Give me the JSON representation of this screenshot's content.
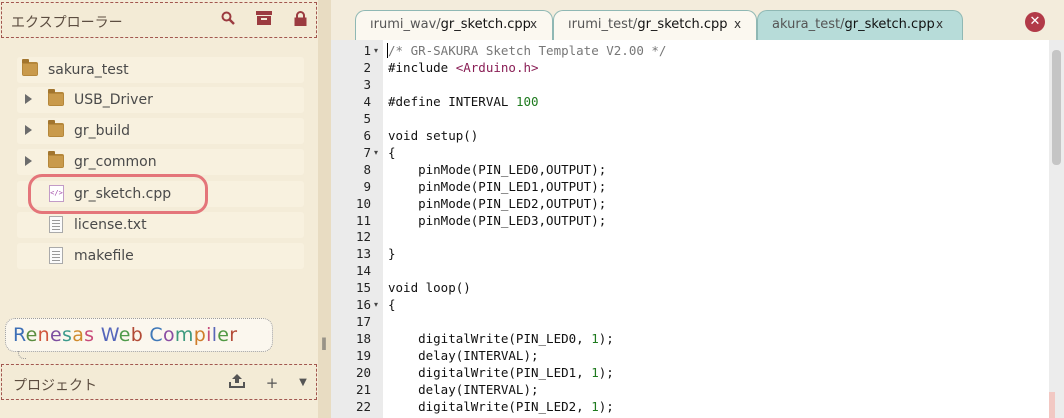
{
  "explorer": {
    "title": "エクスプローラー",
    "icons": [
      "search-icon",
      "archive-icon",
      "lock-icon"
    ],
    "tree": [
      {
        "label": "sakura_test",
        "type": "folder",
        "expandable": false
      },
      {
        "label": "USB_Driver",
        "type": "folder",
        "expandable": true
      },
      {
        "label": "gr_build",
        "type": "folder",
        "expandable": true
      },
      {
        "label": "gr_common",
        "type": "folder",
        "expandable": true
      },
      {
        "label": "gr_sketch.cpp",
        "type": "code-file",
        "highlighted": true
      },
      {
        "label": "license.txt",
        "type": "text-file"
      },
      {
        "label": "makefile",
        "type": "text-file"
      }
    ]
  },
  "logo": {
    "text": "Renesas Web Compiler",
    "letters": [
      "R",
      "e",
      "n",
      "e",
      "s",
      "a",
      "s",
      " ",
      "W",
      "e",
      "b",
      " ",
      "C",
      "o",
      "m",
      "p",
      "i",
      "l",
      "e",
      "r"
    ],
    "colors": [
      "#3d6fb6",
      "#5a8d3f",
      "#d0573d",
      "#7c4ea0",
      "#3c9a8c",
      "#d08a2d",
      "#c84a7a",
      "",
      "#5566bb",
      "#4f9b4a",
      "#b24a36",
      "",
      "#3f78b8",
      "#8a4ea3",
      "#3d9a7e",
      "#cf7d2a",
      "#c64c7b",
      "#5a67b8",
      "#519944",
      "#b44c38"
    ]
  },
  "project": {
    "title": "プロジェクト",
    "icons": [
      "upload-icon",
      "plus-icon",
      "dropdown-icon"
    ],
    "plus_label": "+",
    "dropdown_label": "▼"
  },
  "tabs": [
    {
      "prefix": "ırumi_wav/",
      "name": "gr_sketch.cpp",
      "close": "x",
      "active": false
    },
    {
      "prefix": "ırumi_test/",
      "name": "gr_sketch.cpp",
      "close": "x",
      "active": false
    },
    {
      "prefix": "akura_test/",
      "name": "gr_sketch.cpp",
      "close": "x",
      "active": true
    }
  ],
  "close_all_label": "✕",
  "editor": {
    "lines": [
      {
        "n": "1",
        "fold": true,
        "code": [
          {
            "t": "/* GR-SAKURA Sketch Template V2.00 */",
            "c": "cm"
          }
        ]
      },
      {
        "n": "2",
        "code": [
          {
            "t": "#include "
          },
          {
            "t": "<Arduino.h>",
            "c": "hl-inc"
          }
        ]
      },
      {
        "n": "3",
        "code": []
      },
      {
        "n": "4",
        "code": [
          {
            "t": "#define INTERVAL "
          },
          {
            "t": "100",
            "c": "hl-num"
          }
        ]
      },
      {
        "n": "5",
        "code": []
      },
      {
        "n": "6",
        "code": [
          {
            "t": "void setup()"
          }
        ]
      },
      {
        "n": "7",
        "fold": true,
        "code": [
          {
            "t": "{"
          }
        ]
      },
      {
        "n": "8",
        "code": [
          {
            "t": "    pinMode(PIN_LED0,OUTPUT);"
          }
        ]
      },
      {
        "n": "9",
        "code": [
          {
            "t": "    pinMode(PIN_LED1,OUTPUT);"
          }
        ]
      },
      {
        "n": "10",
        "code": [
          {
            "t": "    pinMode(PIN_LED2,OUTPUT);"
          }
        ]
      },
      {
        "n": "11",
        "code": [
          {
            "t": "    pinMode(PIN_LED3,OUTPUT);"
          }
        ]
      },
      {
        "n": "12",
        "code": []
      },
      {
        "n": "13",
        "code": [
          {
            "t": "}"
          }
        ]
      },
      {
        "n": "14",
        "code": []
      },
      {
        "n": "15",
        "code": [
          {
            "t": "void loop()"
          }
        ]
      },
      {
        "n": "16",
        "fold": true,
        "code": [
          {
            "t": "{"
          }
        ]
      },
      {
        "n": "17",
        "code": []
      },
      {
        "n": "18",
        "code": [
          {
            "t": "    digitalWrite(PIN_LED0, "
          },
          {
            "t": "1",
            "c": "hl-num"
          },
          {
            "t": ");"
          }
        ]
      },
      {
        "n": "19",
        "code": [
          {
            "t": "    delay(INTERVAL);"
          }
        ]
      },
      {
        "n": "20",
        "code": [
          {
            "t": "    digitalWrite(PIN_LED1, "
          },
          {
            "t": "1",
            "c": "hl-num"
          },
          {
            "t": ");"
          }
        ]
      },
      {
        "n": "21",
        "code": [
          {
            "t": "    delay(INTERVAL);"
          }
        ]
      },
      {
        "n": "22",
        "code": [
          {
            "t": "    digitalWrite(PIN_LED2, "
          },
          {
            "t": "1",
            "c": "hl-num"
          },
          {
            "t": ");"
          }
        ]
      }
    ]
  }
}
